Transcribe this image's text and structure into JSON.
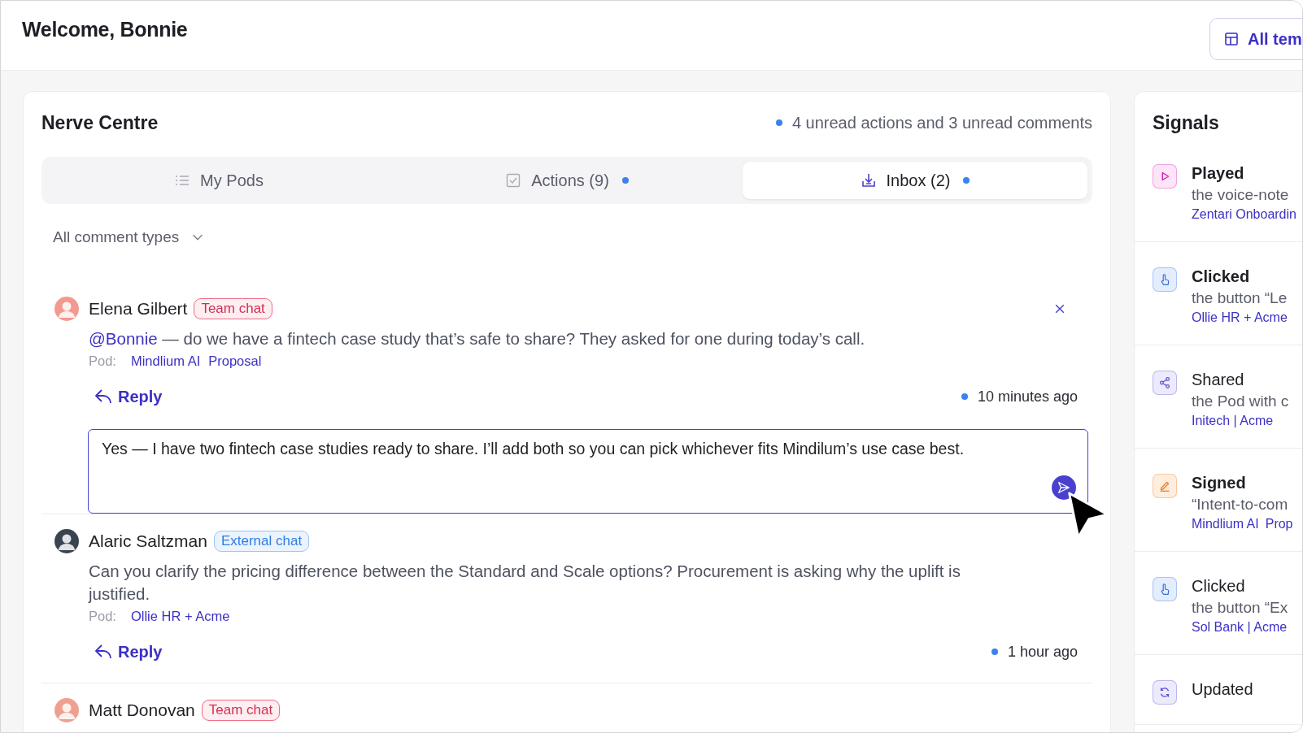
{
  "header": {
    "title": "Welcome, Bonnie",
    "button": "All tem"
  },
  "nerve_centre": {
    "title": "Nerve Centre",
    "summary": "4 unread actions and 3 unread comments",
    "tabs": [
      {
        "kind": "list",
        "label": "My Pods",
        "selected": false,
        "unread": false
      },
      {
        "kind": "check",
        "label": "Actions (9)",
        "selected": false,
        "unread": true
      },
      {
        "kind": "inbox",
        "label": "Inbox (2)",
        "selected": true,
        "unread": true
      }
    ],
    "filter": "All comment types",
    "comments": [
      {
        "name": "Elena Gilbert",
        "tag": {
          "kind": "team",
          "label": "Team chat"
        },
        "mention": "@Bonnie",
        "text": "— do we have a fintech case study that’s safe to share? They asked for one during today’s call.",
        "pod_label": "Pod:",
        "pods": [
          "Mindlium AI",
          "Proposal"
        ],
        "reply": "Reply",
        "time": "10 minutes ago",
        "unread": true,
        "dismissable": true,
        "reply_value": "Yes — I have two fintech case studies ready to share. I’ll add both so you can pick whichever fits Mindilum’s use case best."
      },
      {
        "name": "Alaric Saltzman",
        "tag": {
          "kind": "external",
          "label": "External chat"
        },
        "text": "Can you clarify the pricing difference between the Standard and Scale options? Procurement is asking why the uplift is justified.",
        "pod_label": "Pod:",
        "pods": [
          "Ollie HR + Acme"
        ],
        "reply": "Reply",
        "time": "1 hour ago",
        "unread": true,
        "dismissable": false
      },
      {
        "name": "Matt Donovan",
        "tag": {
          "kind": "team",
          "label": "Team chat"
        }
      }
    ]
  },
  "signals": {
    "title": "Signals",
    "items": [
      {
        "kind": "play",
        "title": "Played",
        "unread": true,
        "text": "the voice-note",
        "links": [
          "Zentari Onboardin"
        ]
      },
      {
        "kind": "click",
        "title": "Clicked",
        "unread": true,
        "text": "the button “Le",
        "links": [
          "Ollie HR + Acme"
        ]
      },
      {
        "kind": "share",
        "title": "Shared",
        "unread": false,
        "text": "the Pod with c",
        "links": [
          "Initech | Acme"
        ]
      },
      {
        "kind": "sign",
        "title": "Signed",
        "unread": true,
        "text": "“Intent-to-com",
        "links": [
          "Mindlium AI",
          "Prop"
        ]
      },
      {
        "kind": "click",
        "title": "Clicked",
        "unread": false,
        "text": "the button “Ex",
        "links": [
          "Sol Bank | Acme"
        ]
      },
      {
        "kind": "update",
        "title": "Updated",
        "unread": false
      }
    ]
  }
}
